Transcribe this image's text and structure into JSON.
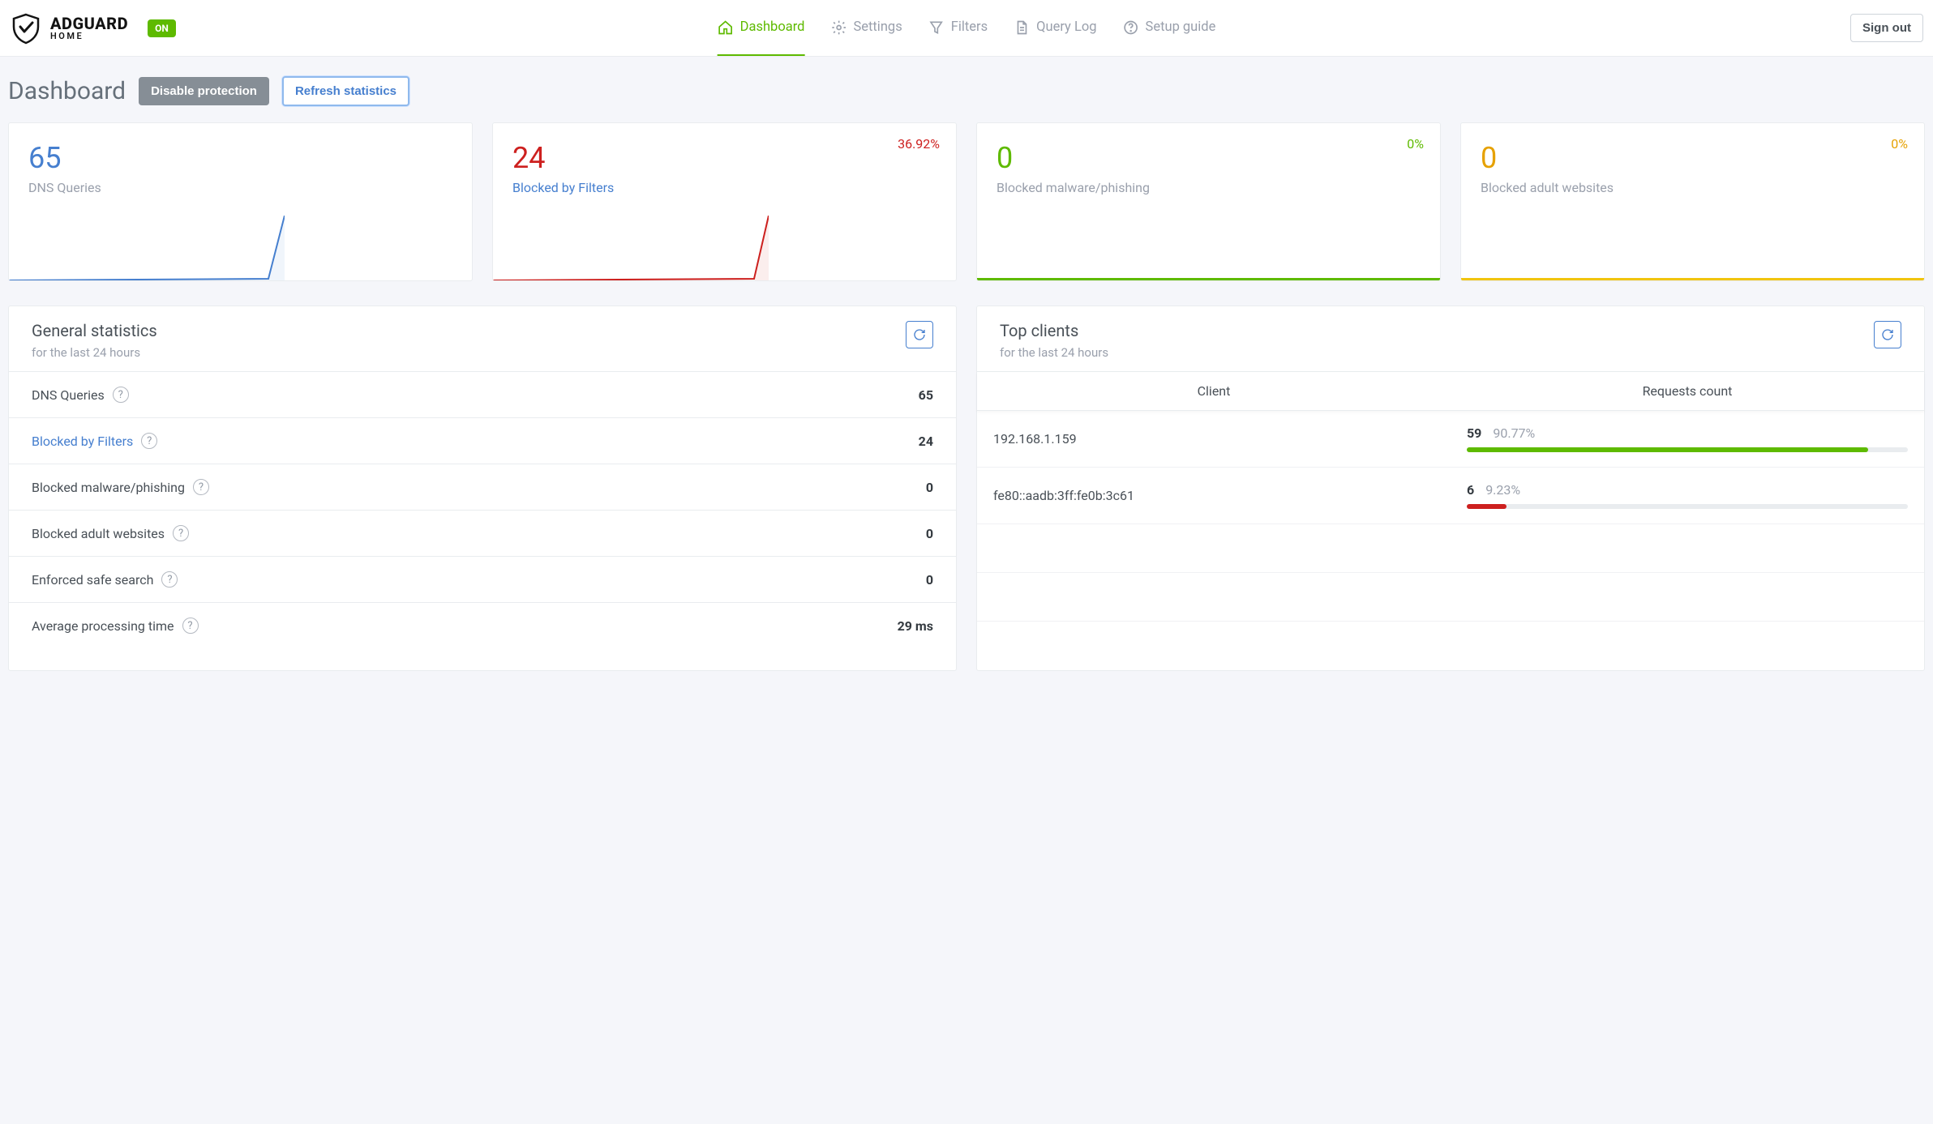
{
  "header": {
    "brand": "ADGUARD",
    "brand_sub": "HOME",
    "status": "ON",
    "nav": [
      "Dashboard",
      "Settings",
      "Filters",
      "Query Log",
      "Setup guide"
    ],
    "signout": "Sign out"
  },
  "page": {
    "title": "Dashboard",
    "disable_btn": "Disable protection",
    "refresh_btn": "Refresh statistics"
  },
  "cards": {
    "dns": {
      "value": "65",
      "label": "DNS Queries"
    },
    "blocked": {
      "value": "24",
      "label": "Blocked by Filters",
      "pct": "36.92%"
    },
    "malware": {
      "value": "0",
      "label": "Blocked malware/phishing",
      "pct": "0%"
    },
    "adult": {
      "value": "0",
      "label": "Blocked adult websites",
      "pct": "0%"
    }
  },
  "general": {
    "title": "General statistics",
    "sub": "for the last 24 hours",
    "rows": [
      {
        "label": "DNS Queries",
        "value": "65",
        "link": false
      },
      {
        "label": "Blocked by Filters",
        "value": "24",
        "link": true
      },
      {
        "label": "Blocked malware/phishing",
        "value": "0",
        "link": false
      },
      {
        "label": "Blocked adult websites",
        "value": "0",
        "link": false
      },
      {
        "label": "Enforced safe search",
        "value": "0",
        "link": false
      },
      {
        "label": "Average processing time",
        "value": "29 ms",
        "link": false
      }
    ]
  },
  "topclients": {
    "title": "Top clients",
    "sub": "for the last 24 hours",
    "col_client": "Client",
    "col_req": "Requests count",
    "rows": [
      {
        "client": "192.168.1.159",
        "count": "59",
        "pct": "90.77%",
        "bar_pct": 91,
        "color": "#5eba00"
      },
      {
        "client": "fe80::aadb:3ff:fe0b:3c61",
        "count": "6",
        "pct": "9.23%",
        "bar_pct": 9,
        "color": "#cd201f"
      }
    ]
  }
}
